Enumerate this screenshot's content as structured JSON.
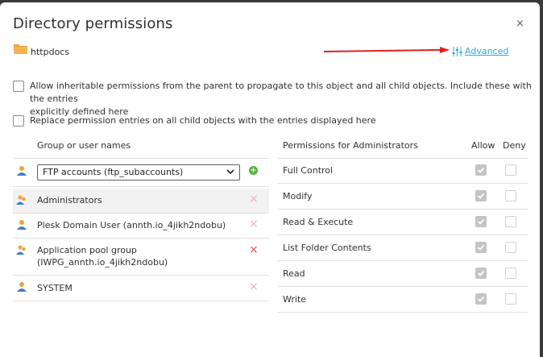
{
  "dialog": {
    "title": "Directory permissions",
    "close_glyph": "×",
    "folder_name": "httpdocs",
    "advanced_label": "Advanced"
  },
  "options": {
    "inherit_line1": "Allow inheritable permissions from the parent to propagate to this object and all child objects. Include these with the entries",
    "inherit_line2": "explicitly defined here",
    "inherit_checked": false,
    "replace_label": "Replace permission entries on all child objects with the entries displayed here",
    "replace_checked": false
  },
  "users": {
    "header": "Group or user names",
    "select_value": "FTP accounts (ftp_subaccounts)",
    "list": [
      {
        "name": "Administrators",
        "selected": true,
        "remove": "×"
      },
      {
        "name": "Plesk Domain User (annth.io_4jikh2ndobu)",
        "selected": false,
        "remove": "×"
      },
      {
        "name_line1": "Application pool group",
        "name_line2": "(IWPG_annth.io_4jikh2ndobu)",
        "selected": false,
        "remove": "×"
      },
      {
        "name": "SYSTEM",
        "selected": false,
        "remove": "×"
      }
    ]
  },
  "permissions": {
    "header": "Permissions for Administrators",
    "allow_header": "Allow",
    "deny_header": "Deny",
    "items": [
      {
        "label": "Full Control",
        "allow": true,
        "deny": false
      },
      {
        "label": "Modify",
        "allow": true,
        "deny": false
      },
      {
        "label": "Read & Execute",
        "allow": true,
        "deny": false
      },
      {
        "label": "List Folder Contents",
        "allow": true,
        "deny": false
      },
      {
        "label": "Read",
        "allow": true,
        "deny": false
      },
      {
        "label": "Write",
        "allow": true,
        "deny": false
      }
    ]
  },
  "colors": {
    "link": "#28aade",
    "folder": "#f0a23a",
    "add": "#52b33c",
    "remove_active": "#e05050",
    "remove_inactive": "#f2b3b3",
    "arrow": "#e02020"
  }
}
